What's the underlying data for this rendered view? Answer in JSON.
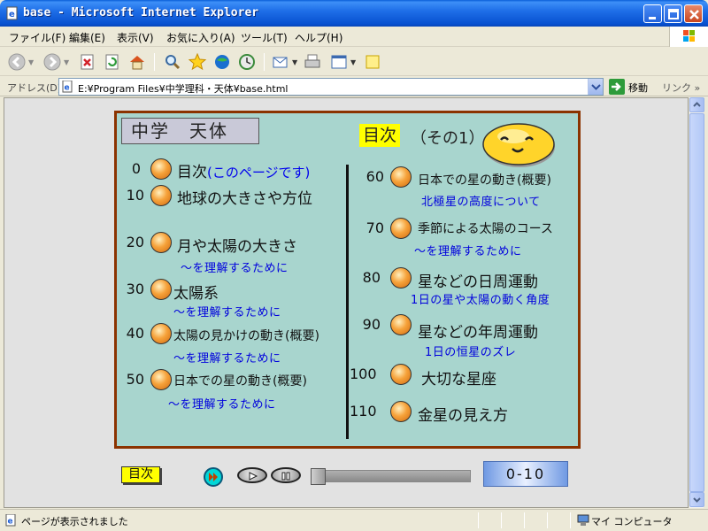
{
  "window": {
    "title": "base - Microsoft Internet Explorer"
  },
  "menubar": {
    "items": [
      "ファイル(F)",
      "編集(E)",
      "表示(V)",
      "お気に入り(A)",
      "ツール(T)",
      "ヘルプ(H)"
    ]
  },
  "addressbar": {
    "label": "アドレス(D)",
    "url": "E:¥Program Files¥中学理科・天体¥base.html",
    "go_label": "移動",
    "links_label": "リンク"
  },
  "page": {
    "title": "中学　天体",
    "toc_label": "目次",
    "toc_part": "（その1）",
    "left_items": [
      {
        "num": "0",
        "title": "目次",
        "here": "(このページです)",
        "sub": ""
      },
      {
        "num": "10",
        "title": "地球の大きさや方位",
        "sub": ""
      },
      {
        "num": "20",
        "title": "月や太陽の大きさ",
        "sub": "～を理解するために"
      },
      {
        "num": "30",
        "title": "太陽系",
        "sub": "～を理解するために"
      },
      {
        "num": "40",
        "title": "太陽の見かけの動き(概要)",
        "sub": "～を理解するために"
      },
      {
        "num": "50",
        "title": "日本での星の動き(概要)",
        "sub": "～を理解するために"
      }
    ],
    "right_items": [
      {
        "num": "60",
        "title": "日本での星の動き(概要)",
        "sub": "北極星の高度について"
      },
      {
        "num": "70",
        "title": "季節による太陽のコース",
        "sub": "～を理解するために"
      },
      {
        "num": "80",
        "title": "星などの日周運動",
        "sub": "1日の星や太陽の動く角度"
      },
      {
        "num": "90",
        "title": "星などの年周運動",
        "sub": "1日の恒星のズレ"
      },
      {
        "num": "100",
        "title": "大切な星座",
        "sub": ""
      },
      {
        "num": "110",
        "title": "金星の見え方",
        "sub": ""
      }
    ]
  },
  "controls": {
    "toc_button": "目次",
    "range_label": "0-10",
    "slider_position": 0
  },
  "statusbar": {
    "text": "ページが表示されました",
    "zone": "マイ コンピュータ"
  },
  "colors": {
    "panel_bg": "#a8d5ce",
    "panel_border": "#8b3300",
    "link_blue": "#0000dd",
    "toc_yellow": "#ffff00"
  }
}
